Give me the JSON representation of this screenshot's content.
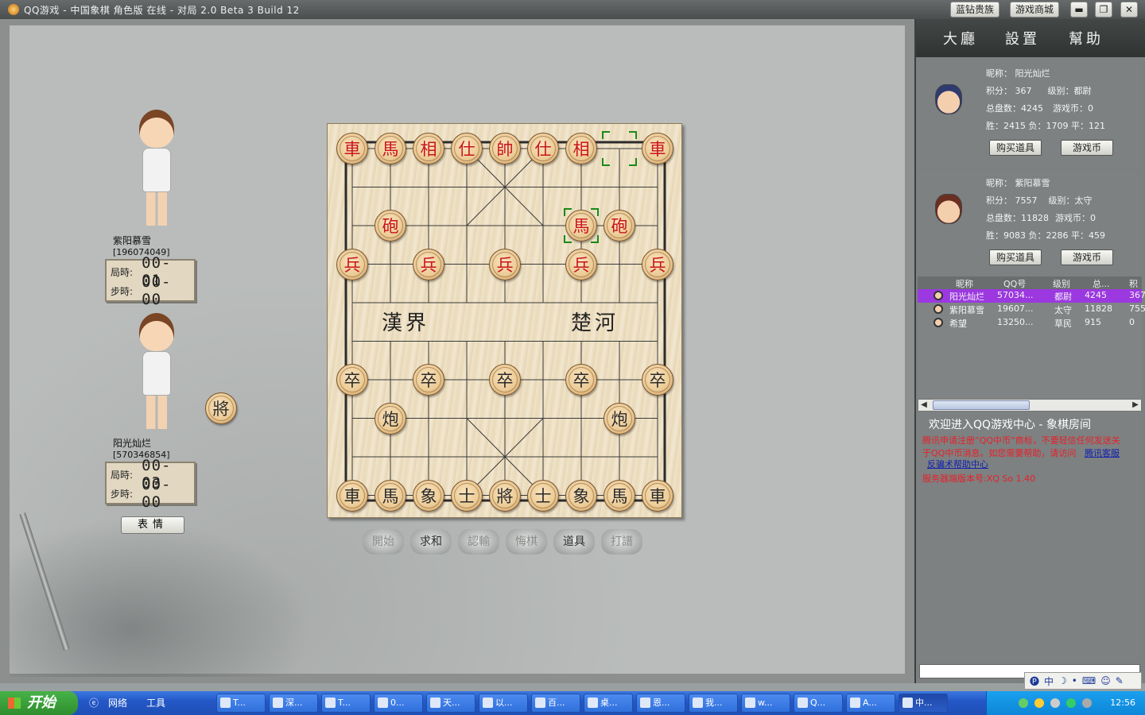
{
  "window": {
    "title": "QQ游戏 - 中国象棋 角色版 在线 - 对局 2.0 Beta 3 Build 12",
    "btn_vip": "蓝钻贵族",
    "btn_shop": "游戏商城",
    "btn_min": "▬",
    "btn_restore": "❐",
    "btn_close": "✕"
  },
  "players": {
    "top": {
      "name": "紫阳慕雪",
      "id": "[196074049]",
      "game_label": "局時:",
      "game_time": "00-01",
      "step_label": "步時:",
      "step_time": "00-00"
    },
    "bottom": {
      "name": "阳光灿烂",
      "id": "[570346854]",
      "game_label": "局時:",
      "game_time": "00-03",
      "step_label": "步時:",
      "step_time": "00-00",
      "side_piece": "將"
    }
  },
  "expr_button": "表情",
  "board": {
    "river_left": "漢界",
    "river_right": "楚河",
    "pieces": [
      {
        "c": "red",
        "t": "車",
        "col": 0,
        "row": 0
      },
      {
        "c": "red",
        "t": "馬",
        "col": 1,
        "row": 0
      },
      {
        "c": "red",
        "t": "相",
        "col": 2,
        "row": 0
      },
      {
        "c": "red",
        "t": "仕",
        "col": 3,
        "row": 0
      },
      {
        "c": "red",
        "t": "帥",
        "col": 4,
        "row": 0
      },
      {
        "c": "red",
        "t": "仕",
        "col": 5,
        "row": 0
      },
      {
        "c": "red",
        "t": "相",
        "col": 6,
        "row": 0
      },
      {
        "c": "red",
        "t": "車",
        "col": 8,
        "row": 0
      },
      {
        "c": "red",
        "t": "砲",
        "col": 1,
        "row": 2
      },
      {
        "c": "red",
        "t": "馬",
        "col": 6,
        "row": 2
      },
      {
        "c": "red",
        "t": "砲",
        "col": 7,
        "row": 2
      },
      {
        "c": "red",
        "t": "兵",
        "col": 0,
        "row": 3
      },
      {
        "c": "red",
        "t": "兵",
        "col": 2,
        "row": 3
      },
      {
        "c": "red",
        "t": "兵",
        "col": 4,
        "row": 3
      },
      {
        "c": "red",
        "t": "兵",
        "col": 6,
        "row": 3
      },
      {
        "c": "red",
        "t": "兵",
        "col": 8,
        "row": 3
      },
      {
        "c": "black",
        "t": "卒",
        "col": 0,
        "row": 6
      },
      {
        "c": "black",
        "t": "卒",
        "col": 2,
        "row": 6
      },
      {
        "c": "black",
        "t": "卒",
        "col": 4,
        "row": 6
      },
      {
        "c": "black",
        "t": "卒",
        "col": 6,
        "row": 6
      },
      {
        "c": "black",
        "t": "卒",
        "col": 8,
        "row": 6
      },
      {
        "c": "black",
        "t": "炮",
        "col": 1,
        "row": 7
      },
      {
        "c": "black",
        "t": "炮",
        "col": 7,
        "row": 7
      },
      {
        "c": "black",
        "t": "車",
        "col": 0,
        "row": 9
      },
      {
        "c": "black",
        "t": "馬",
        "col": 1,
        "row": 9
      },
      {
        "c": "black",
        "t": "象",
        "col": 2,
        "row": 9
      },
      {
        "c": "black",
        "t": "士",
        "col": 3,
        "row": 9
      },
      {
        "c": "black",
        "t": "將",
        "col": 4,
        "row": 9
      },
      {
        "c": "black",
        "t": "士",
        "col": 5,
        "row": 9
      },
      {
        "c": "black",
        "t": "象",
        "col": 6,
        "row": 9
      },
      {
        "c": "black",
        "t": "馬",
        "col": 7,
        "row": 9
      },
      {
        "c": "black",
        "t": "車",
        "col": 8,
        "row": 9
      }
    ],
    "last_move_from": {
      "col": 7,
      "row": 0
    },
    "last_move_to": {
      "col": 6,
      "row": 2
    }
  },
  "actions": [
    {
      "label": "開始",
      "enabled": false
    },
    {
      "label": "求和",
      "enabled": true
    },
    {
      "label": "認輸",
      "enabled": false
    },
    {
      "label": "悔棋",
      "enabled": false
    },
    {
      "label": "道具",
      "enabled": true
    },
    {
      "label": "打譜",
      "enabled": false
    }
  ],
  "right_nav": {
    "hall": "大廳",
    "settings": "設置",
    "help": "幫助"
  },
  "cards": [
    {
      "nick_label": "昵称：",
      "nick": "阳光灿烂",
      "score_label": "积分：",
      "score": "367",
      "level_label": "级别：",
      "level": "都尉",
      "games_label": "总盘数：",
      "games": "4245",
      "coins_label": "游戏币：",
      "coins": "0",
      "win_label": "胜：",
      "win": "2415",
      "lose_label": "负：",
      "lose": "1709",
      "draw_label": "平：",
      "draw": "121",
      "buy": "购买道具",
      "coin_btn": "游戏币"
    },
    {
      "nick_label": "昵称：",
      "nick": "紫阳慕雪",
      "score_label": "积分：",
      "score": "7557",
      "level_label": "级别：",
      "level": "太守",
      "games_label": "总盘数：",
      "games": "11828",
      "coins_label": "游戏币：",
      "coins": "0",
      "win_label": "胜：",
      "win": "9083",
      "lose_label": "负：",
      "lose": "2286",
      "draw_label": "平：",
      "draw": "459",
      "buy": "购买道具",
      "coin_btn": "游戏币"
    }
  ],
  "userlist": {
    "headers": [
      "昵称",
      "QQ号",
      "级别",
      "总...",
      "积"
    ],
    "rows": [
      {
        "name": "阳光灿烂",
        "qq": "57034...",
        "level": "都尉",
        "total": "4245",
        "score": "367",
        "selected": true
      },
      {
        "name": "紫阳慕雪",
        "qq": "19607...",
        "level": "太守",
        "total": "11828",
        "score": "755",
        "selected": false
      },
      {
        "name": "希望",
        "qq": "13250...",
        "level": "草民",
        "total": "915",
        "score": "0",
        "selected": false
      }
    ]
  },
  "chat": {
    "welcome": "欢迎进入QQ游戏中心 - 象棋房间",
    "lines": [
      "腾讯申请注册“QQ中币”商标，不要轻信任何发送关",
      "于QQ中币消息。如您需要帮助，请访问",
      "反骗术帮助中心"
    ],
    "link": "腾讯客服",
    "version": "服务器端版本号:XQ So 1.40"
  },
  "ime": {
    "label": "中"
  },
  "taskbar": {
    "start": "开始",
    "net": "网络",
    "tools": "工具",
    "items": [
      "T...",
      "深...",
      "T...",
      "0...",
      "天...",
      "以...",
      "百...",
      "桌...",
      "恩...",
      "我...",
      "w...",
      "Q...",
      "A...",
      "中..."
    ],
    "time": "12:56"
  }
}
